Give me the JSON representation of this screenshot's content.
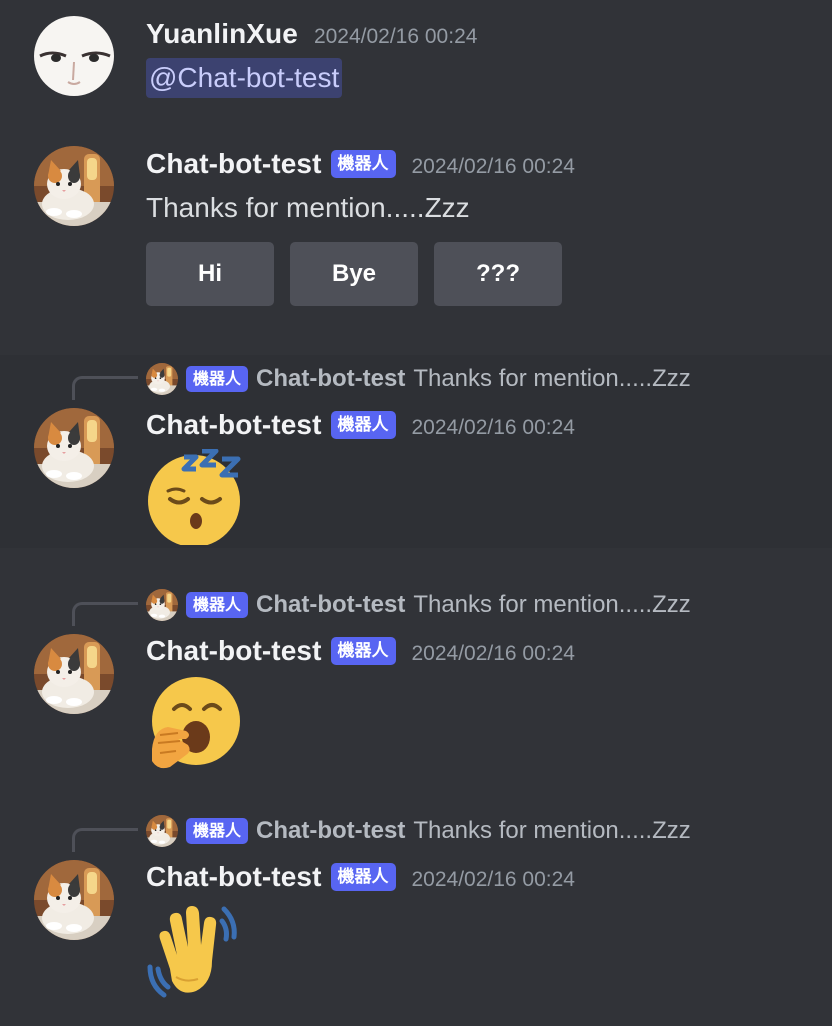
{
  "messages": [
    {
      "author": "YuanlinXue",
      "timestamp": "2024/02/16 00:24",
      "mention": "@Chat-bot-test"
    },
    {
      "author": "Chat-bot-test",
      "tag": "機器人",
      "timestamp": "2024/02/16 00:24",
      "text": "Thanks for mention.....Zzz",
      "buttons": [
        "Hi",
        "Bye",
        "???"
      ]
    },
    {
      "reply": {
        "tag": "機器人",
        "author": "Chat-bot-test",
        "text": "Thanks for mention.....Zzz"
      },
      "author": "Chat-bot-test",
      "tag": "機器人",
      "timestamp": "2024/02/16 00:24",
      "emoji": "sleeping-face-icon"
    },
    {
      "reply": {
        "tag": "機器人",
        "author": "Chat-bot-test",
        "text": "Thanks for mention.....Zzz"
      },
      "author": "Chat-bot-test",
      "tag": "機器人",
      "timestamp": "2024/02/16 00:24",
      "emoji": "yawning-face-icon"
    },
    {
      "reply": {
        "tag": "機器人",
        "author": "Chat-bot-test",
        "text": "Thanks for mention.....Zzz"
      },
      "author": "Chat-bot-test",
      "tag": "機器人",
      "timestamp": "2024/02/16 00:24",
      "emoji": "waving-hand-icon"
    }
  ],
  "colors": {
    "background": "#313338",
    "highlight_row": "#2e3035",
    "bot_tag": "#5865f2",
    "mention_bg": "#3c4270",
    "button_bg": "#4e5058"
  }
}
